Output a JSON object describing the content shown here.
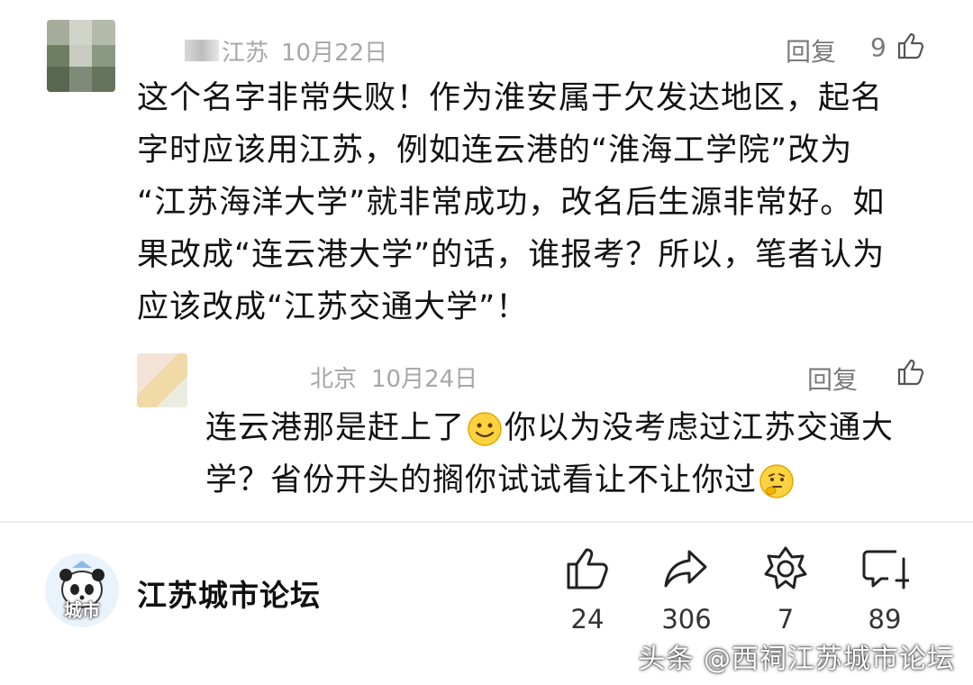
{
  "comment": {
    "location": "江苏",
    "date": "10月22日",
    "reply_label": "回复",
    "like_count": "9",
    "text": "这个名字非常失败！作为淮安属于欠发达地区，起名\n字时应该用江苏，例如连云港的“淮海工学院”改为\n“江苏海洋大学”就非常成功，改名后生源非常好。如\n果改成“连云港大学”的话，谁报考？所以，笔者认为\n应该改成“江苏交通大学”！"
  },
  "reply": {
    "location": "北京",
    "date": "10月24日",
    "reply_label": "回复",
    "text_part1": "连云港那是赶上了",
    "text_part2": "你以为没考虑过江苏交通大\n学？省份开头的搁你试试看让不让你过",
    "emoji1": "smile-emoji",
    "emoji2": "thinking-emoji"
  },
  "author": {
    "name": "江苏城市论坛",
    "logo_text": "城市"
  },
  "actions": {
    "like": {
      "icon": "thumbs-up-icon",
      "count": "24"
    },
    "share": {
      "icon": "share-icon",
      "count": "306"
    },
    "favorite": {
      "icon": "star-icon",
      "count": "7"
    },
    "comment": {
      "icon": "comment-icon",
      "count": "89"
    }
  },
  "watermark": "头条 @西祠江苏城市论坛"
}
